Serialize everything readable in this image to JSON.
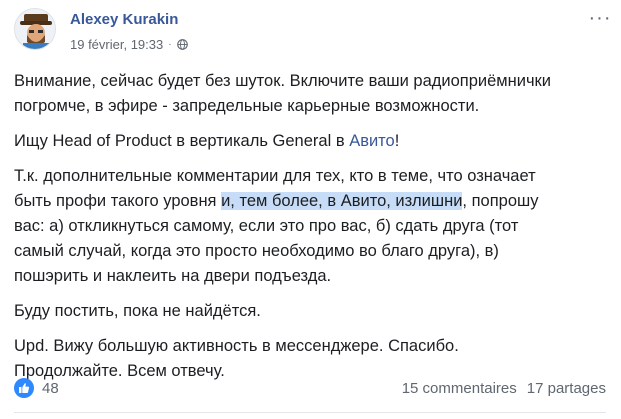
{
  "post": {
    "author": "Alexey Kurakin",
    "timestamp": "19 février, 19:33",
    "separator": "·",
    "privacy_icon": "globe-icon",
    "more_label": "···",
    "paragraphs": {
      "p1": {
        "l1": "Внимание, сейчас будет без шуток. Включите ваши радиоприёмнички",
        "l2": "погромче, в эфире - запредельные карьерные возможности."
      },
      "p2": {
        "before": "Ищу Head of Product в вертикаль General в ",
        "link": "Авито",
        "after": "!"
      },
      "p3": {
        "l1": "Т.к. дополнительные комментарии для тех, кто в теме, что означает",
        "l2_before": "быть профи такого уровня ",
        "l2_highlight": "и, тем более, в Авито, излишни",
        "l2_after": ", попрошу",
        "l3": "вас: а) откликнуться самому, если это про вас, б) сдать друга (тот",
        "l4": "самый случай, когда это просто необходимо во благо друга), в)",
        "l5": "пошэрить и наклеить на двери подъезда."
      },
      "p4": "Буду постить, пока не найдётся.",
      "p5": {
        "l1": "Upd. Вижу большую активность в мессенджере. Спасибо.",
        "l2": "Продолжайте. Всем отвечу."
      }
    },
    "reactions": {
      "icon": "like-icon",
      "count": "48",
      "accent": "#2e89ff"
    },
    "comments": "15 commentaires",
    "shares": "17 partages"
  }
}
